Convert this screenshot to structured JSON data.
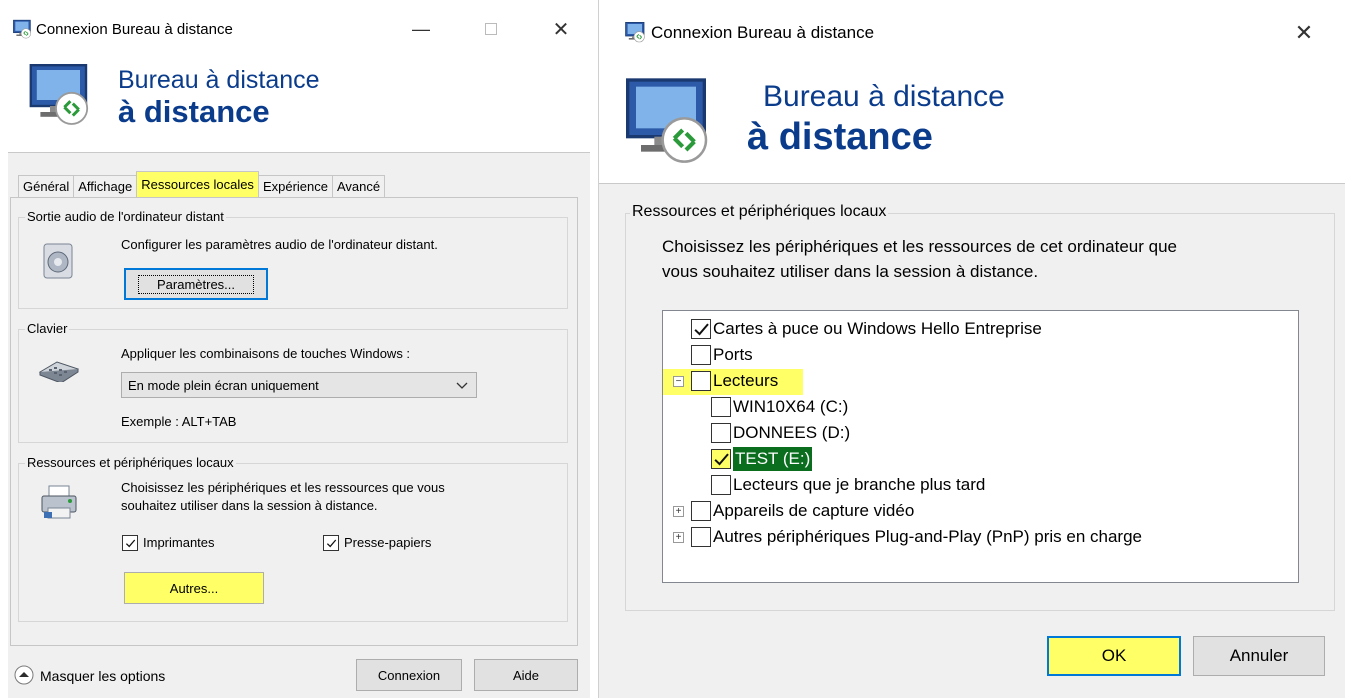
{
  "left_window": {
    "title": "Connexion Bureau à distance",
    "banner_line1": "Bureau à distance",
    "banner_line2": "à distance",
    "tabs": [
      {
        "label": "Général",
        "active": false
      },
      {
        "label": "Affichage",
        "active": false
      },
      {
        "label": "Ressources locales",
        "active": true
      },
      {
        "label": "Expérience",
        "active": false
      },
      {
        "label": "Avancé",
        "active": false
      }
    ],
    "audio": {
      "legend": "Sortie audio de l'ordinateur distant",
      "description": "Configurer les paramètres audio de l'ordinateur distant.",
      "button": "Paramètres..."
    },
    "keyboard": {
      "legend": "Clavier",
      "description": "Appliquer les combinaisons de touches Windows :",
      "selected": "En mode plein écran uniquement",
      "example": "Exemple : ALT+TAB"
    },
    "resources": {
      "legend": "Ressources et périphériques locaux",
      "description_line1": "Choisissez les périphériques et les ressources que vous",
      "description_line2": "souhaitez utiliser dans la session à distance.",
      "printers_label": "Imprimantes",
      "printers_checked": true,
      "clipboard_label": "Presse-papiers",
      "clipboard_checked": true,
      "more_button": "Autres..."
    },
    "footer": {
      "toggle_label": "Masquer les options",
      "connect_button": "Connexion",
      "help_button": "Aide"
    }
  },
  "right_window": {
    "title": "Connexion Bureau à distance",
    "banner_line1": "Bureau à distance",
    "banner_line2": "à distance",
    "group_legend": "Ressources et périphériques locaux",
    "description_line1": "Choisissez les périphériques et les ressources de cet ordinateur que",
    "description_line2": "vous souhaitez utiliser dans la session à distance.",
    "tree": [
      {
        "label": "Cartes à puce ou Windows Hello Entreprise",
        "checked": true,
        "level": 0,
        "expander": ""
      },
      {
        "label": "Ports",
        "checked": false,
        "level": 0,
        "expander": ""
      },
      {
        "label": "Lecteurs",
        "checked": false,
        "level": 0,
        "expander": "−"
      },
      {
        "label": "WIN10X64 (C:)",
        "checked": false,
        "level": 1,
        "expander": ""
      },
      {
        "label": "DONNEES (D:)",
        "checked": false,
        "level": 1,
        "expander": ""
      },
      {
        "label": "TEST (E:)",
        "checked": true,
        "level": 1,
        "expander": ""
      },
      {
        "label": "Lecteurs que je branche plus tard",
        "checked": false,
        "level": 1,
        "expander": ""
      },
      {
        "label": "Appareils de capture vidéo",
        "checked": false,
        "level": 0,
        "expander": "+"
      },
      {
        "label": "Autres périphériques Plug-and-Play (PnP) pris en charge",
        "checked": false,
        "level": 0,
        "expander": "+"
      }
    ],
    "ok_button": "OK",
    "cancel_button": "Annuler"
  },
  "colors": {
    "highlight": "#ffff66",
    "selection": "#0a6e1e",
    "banner_text": "#0b3c8c",
    "focus_border": "#0078d7"
  }
}
